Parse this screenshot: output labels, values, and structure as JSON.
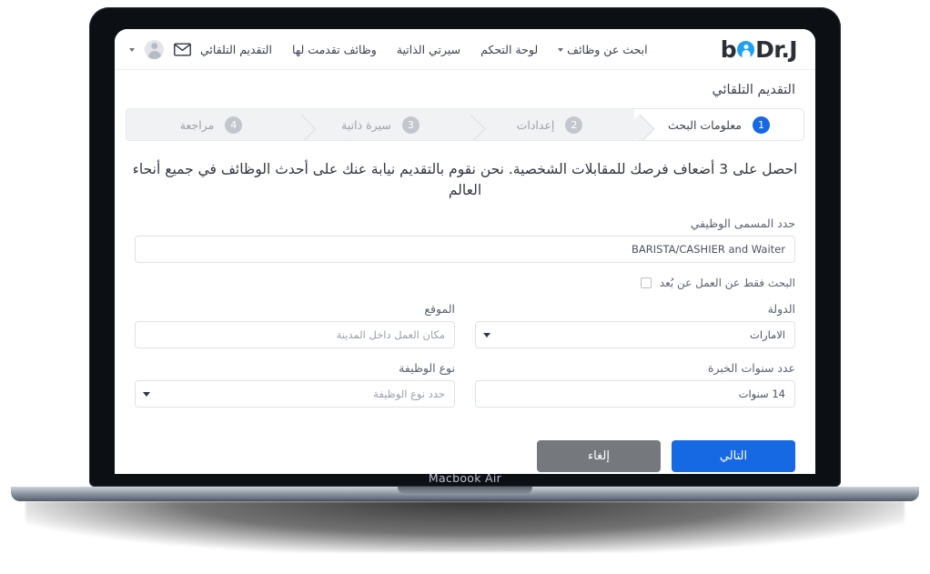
{
  "device": {
    "label": "Macbook Air"
  },
  "header": {
    "logo": {
      "prefix": "Dr.J",
      "circle_icon": "person-circle-icon",
      "suffix": "b",
      "accent": "#1da1f2"
    },
    "nav": [
      {
        "label": "ابحث عن وظائف",
        "has_caret": true
      },
      {
        "label": "لوحة التحكم",
        "has_caret": false
      },
      {
        "label": "سيرتي الذاتية",
        "has_caret": false
      },
      {
        "label": "وظائف تقدمت لها",
        "has_caret": false
      },
      {
        "label": "التقديم التلقائي",
        "has_caret": false
      }
    ],
    "mail_icon": "envelope-icon",
    "avatar_icon": "avatar-icon",
    "avatar_caret_icon": "chevron-down-icon"
  },
  "page": {
    "title": "التقديم التلقائي",
    "intro": "احصل على 3 أضعاف فرصك للمقابلات الشخصية. نحن نقوم بالتقديم نيابة عنك على أحدث الوظائف في جميع أنحاء العالم"
  },
  "stepper": {
    "steps": [
      {
        "number": "1",
        "label": "معلومات البحث",
        "active": true
      },
      {
        "number": "2",
        "label": "إعدادات",
        "active": false
      },
      {
        "number": "3",
        "label": "سيرة ذاتية",
        "active": false
      },
      {
        "number": "4",
        "label": "مراجعة",
        "active": false
      }
    ],
    "active_color": "#1668e3",
    "inactive_color": "#c3c7cd"
  },
  "form": {
    "job_title": {
      "label": "حدد المسمى الوظيفي",
      "value": "BARISTA/CASHIER and Waiter",
      "placeholder": ""
    },
    "remote_only": {
      "label": "البحث فقط عن العمل عن بُعد",
      "checked": false
    },
    "country": {
      "label": "الدولة",
      "value": "الامارات",
      "dropdown_icon": "chevron-down-icon"
    },
    "location": {
      "label": "الموقع",
      "value": "",
      "placeholder": "مكان العمل داخل المدينة"
    },
    "experience": {
      "label": "عدد سنوات الخبرة",
      "value": "14 سنوات",
      "placeholder": ""
    },
    "job_type": {
      "label": "نوع الوظيفة",
      "value": "",
      "placeholder": "حدد نوع الوظيفة",
      "dropdown_icon": "chevron-down-icon"
    }
  },
  "actions": {
    "next_label": "التالي",
    "cancel_label": "إلغاء",
    "primary_color": "#1668e3",
    "secondary_color": "#75797d"
  }
}
